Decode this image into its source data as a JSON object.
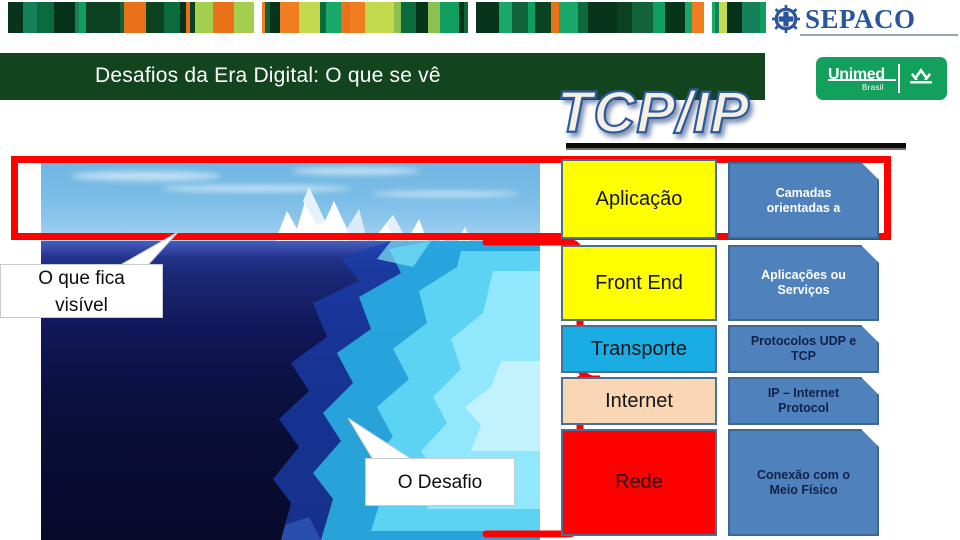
{
  "brand": {
    "sepaco_name": "SEPACO",
    "sepaco_icon": "gear-cross-emblem",
    "sepaco_color": "#28559b",
    "unimed_name": "Unimed",
    "unimed_sub": "Brasil",
    "unimed_color": "#13a05c"
  },
  "header": {
    "title": "Desafios da Era Digital: O que se vê",
    "title_bar_color": "#12441e",
    "wordart_title": "TCP/IP",
    "wordart_fill": "#f5f0e1",
    "wordart_outline": "#2f5a9e"
  },
  "photo": {
    "caption_name": "iceberg-photo"
  },
  "callouts": [
    {
      "id": "visivel",
      "text": "O que fica\nvisível",
      "line1": "O que fica",
      "line2": "visível"
    },
    {
      "id": "desafio",
      "text": "O Desafio",
      "line1": "O Desafio",
      "line2": ""
    }
  ],
  "highlight": {
    "red_rect_color": "#ff0000",
    "brace_color": "#ff0000"
  },
  "model": {
    "layers": [
      {
        "name": "Aplicação",
        "color": "#ffff00",
        "text_color": "#141414",
        "desc": "Camadas orientadas a",
        "desc_l1": "Camadas",
        "desc_l2": "orientadas a",
        "desc_text_color": "#ffffff"
      },
      {
        "name": "Front End",
        "color": "#ffff00",
        "text_color": "#141414",
        "desc": "Aplicações ou Serviços",
        "desc_l1": "Aplicações ou",
        "desc_l2": "Serviços",
        "desc_text_color": "#ffffff"
      },
      {
        "name": "Transporte",
        "color": "#1aade4",
        "text_color": "#141414",
        "desc": "Protocolos UDP e TCP",
        "desc_l1": "Protocolos UDP e",
        "desc_l2": "TCP",
        "desc_text_color": "#10224a"
      },
      {
        "name": "Internet",
        "color": "#fad7b4",
        "text_color": "#141414",
        "desc": "IP – Internet Protocol",
        "desc_l1": "IP – Internet",
        "desc_l2": "Protocol",
        "desc_text_color": "#10224a"
      },
      {
        "name": "Rede",
        "color": "#ff0000",
        "text_color": "#2a0a0a",
        "desc": "Conexão com o Meio Físico",
        "desc_l1": "Conexão com o",
        "desc_l2": "Meio Físico",
        "desc_text_color": "#10224a"
      }
    ],
    "desc_box_color": "#4f81bd"
  },
  "stripes": {
    "palette": [
      "#0d4220",
      "#8cc152",
      "#0f9e5e",
      "#07351b",
      "#f07d22",
      "#1aa86a",
      "#0a6b3c",
      "#c3d94e",
      "#12623a",
      "#a4cf4e",
      "#e8711a",
      "#05331a",
      "#14815a"
    ]
  }
}
